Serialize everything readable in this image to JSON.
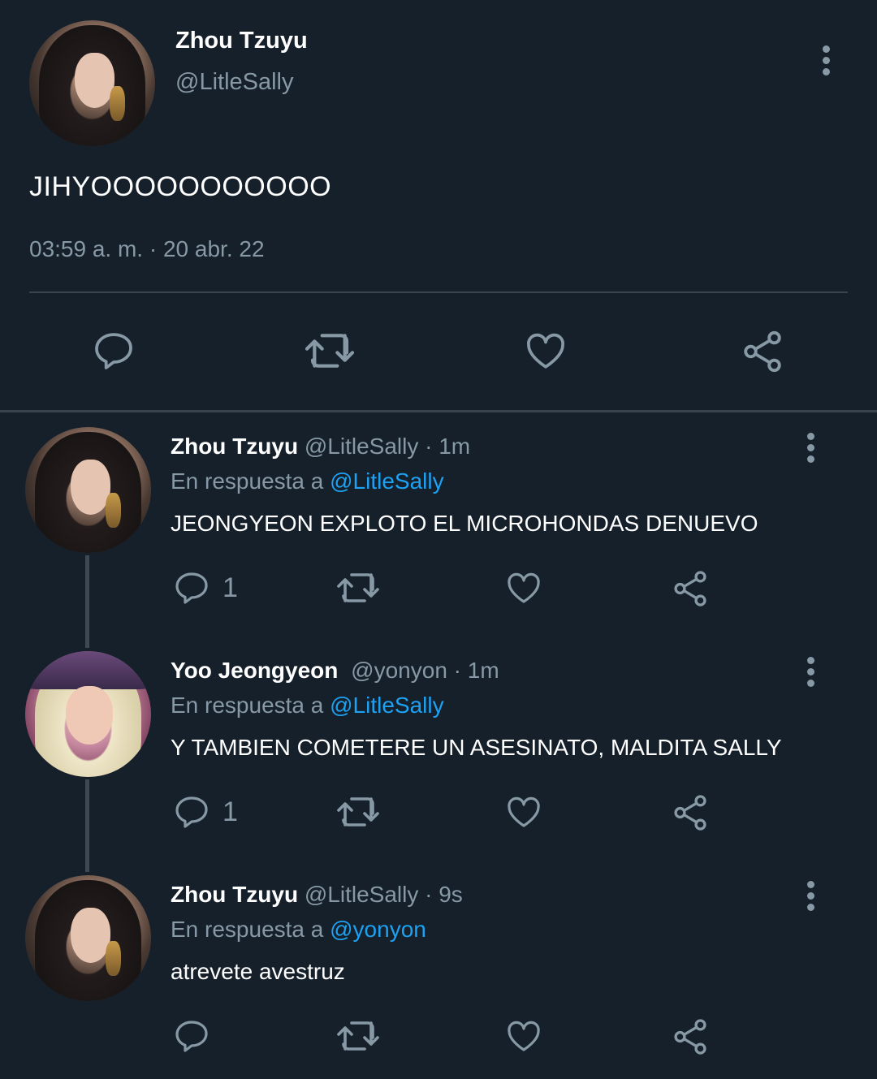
{
  "main_tweet": {
    "author_name": "Zhou Tzuyu",
    "author_handle": "@LitleSally",
    "text": "JIHYOOOOOOOOOOO",
    "timestamp": "03:59 a. m. · 20 abr. 22",
    "actions": [
      "reply-icon",
      "retweet-icon",
      "like-icon",
      "share-icon"
    ]
  },
  "replies": [
    {
      "author_name": "Zhou Tzuyu",
      "author_handle": "@LitleSally",
      "time": "· 1m",
      "reply_prefix": "En respuesta a ",
      "reply_to": "@LitleSally",
      "text": "JEONGYEON EXPLOTO EL MICROHONDAS DENUEVO",
      "reply_count": "1"
    },
    {
      "author_name": "Yoo Jeongyeon",
      "author_handle": "@yonyon",
      "time": "· 1m",
      "reply_prefix": "En respuesta a ",
      "reply_to": "@LitleSally",
      "text": "Y TAMBIEN COMETERE UN ASESINATO, MALDITA SALLY",
      "reply_count": "1"
    },
    {
      "author_name": "Zhou Tzuyu",
      "author_handle": "@LitleSally",
      "time": "· 9s",
      "reply_prefix": "En respuesta a ",
      "reply_to": "@yonyon",
      "text": "atrevete avestruz",
      "reply_count": ""
    }
  ],
  "colors": {
    "background": "#15202b",
    "secondary_text": "#8899a6",
    "link": "#1da1f2",
    "divider": "#38444d"
  }
}
